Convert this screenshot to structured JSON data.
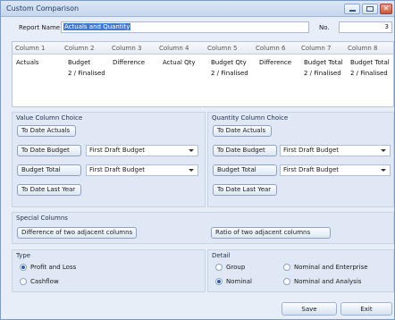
{
  "window": {
    "title": "Custom Comparison"
  },
  "report": {
    "name_label": "Report Name",
    "name_value": "Actuals and Quantity",
    "no_label": "No.",
    "no_value": "3"
  },
  "grid": {
    "columns": [
      "Column 1",
      "Column 2",
      "Column 3",
      "Column 4",
      "Column 5",
      "Column 6",
      "Column 7",
      "Column 8"
    ],
    "row1": [
      "Actuals",
      "Budget",
      "Difference",
      "Actual Qty",
      "Budget Qty",
      "Difference",
      "Budget Total",
      "Budget Total"
    ],
    "row2": [
      "",
      "2 / Finalised",
      "",
      "",
      "2 / Finalised",
      "",
      "2 / Finalised",
      "2 / Finalised"
    ]
  },
  "value_choice": {
    "title": "Value Column Choice",
    "btn_actuals": "To Date Actuals",
    "btn_budget": "To Date Budget",
    "budget_combo": "First Draft Budget",
    "btn_total": "Budget Total",
    "total_combo": "First Draft Budget",
    "btn_last_year": "To Date Last Year"
  },
  "quantity_choice": {
    "title": "Quantity Column Choice",
    "btn_actuals": "To Date Actuals",
    "btn_budget": "To Date Budget",
    "budget_combo": "First Draft Budget",
    "btn_total": "Budget Total",
    "total_combo": "First Draft Budget",
    "btn_last_year": "To Date Last Year"
  },
  "special": {
    "title": "Special Columns",
    "btn_diff": "Difference of two adjacent columns",
    "btn_ratio": "Ratio of two adjacent columns"
  },
  "type": {
    "title": "Type",
    "opt_pl": "Profit and Loss",
    "opt_cash": "Cashflow"
  },
  "detail": {
    "title": "Detail",
    "opt_group": "Group",
    "opt_nominal": "Nominal",
    "opt_nom_ent": "Nominal and Enterprise",
    "opt_nom_an": "Nominal and Analysis"
  },
  "actions": {
    "save": "Save",
    "exit": "Exit"
  }
}
